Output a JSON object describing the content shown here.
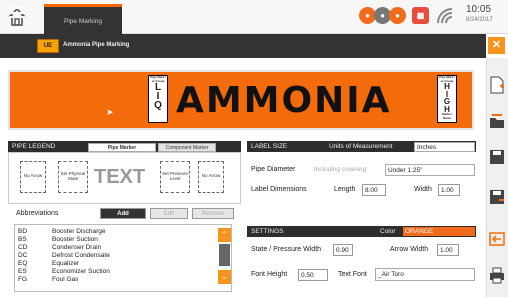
{
  "topbar": {
    "tab_label": "Pipe Marking",
    "clock_time": "10:05",
    "clock_date": "8/24/2017"
  },
  "app": {
    "title": "Ammonia Pipe Marking",
    "logo_text": "UE"
  },
  "label": {
    "main_text": "AMMONIA",
    "left_block": {
      "top": "Pipe Mark / or Group",
      "letters": [
        "L",
        "I",
        "Q"
      ],
      "bottom": ""
    },
    "right_block": {
      "top": "Pipe Mark / or Group",
      "letters": [
        "H",
        "I",
        "G",
        "H"
      ],
      "bottom": "Marker Name"
    },
    "color": "#f36b0a"
  },
  "pipe_legend": {
    "title": "PIPE LEGEND",
    "tabs": [
      "Pipe Marker",
      "Component Marker"
    ],
    "boxes": [
      "No Arrow",
      "Set Physical State",
      "Set Pressure Level",
      "No Arrow"
    ],
    "center_text": "TEXT"
  },
  "abbreviations": {
    "label": "Abbreviations",
    "add": "Add",
    "edit": "Edit",
    "remove": "Remove",
    "rows": [
      {
        "code": "BD",
        "desc": "Booster Discharge"
      },
      {
        "code": "BS",
        "desc": "Booster Suction"
      },
      {
        "code": "CD",
        "desc": "Condenser Drain"
      },
      {
        "code": "DC",
        "desc": "Defrost Condensate"
      },
      {
        "code": "EQ",
        "desc": "Equalizer"
      },
      {
        "code": "ES",
        "desc": "Economizer Suction"
      },
      {
        "code": "FG",
        "desc": "Foul Gas"
      }
    ]
  },
  "label_size": {
    "title": "LABEL SIZE",
    "units_label": "Units of Measurement",
    "units_value": "Inches",
    "pipe_diameter_label": "Pipe Diameter",
    "including_covering": "Including covering",
    "pipe_diameter_value": "Under 1.25\"",
    "dimensions_label": "Label Dimensions",
    "length_label": "Length",
    "length_value": "8.00",
    "width_label": "Width",
    "width_value": "1.00"
  },
  "settings": {
    "title": "SETTINGS",
    "color_label": "Color",
    "color_value": "ORANGE",
    "state_width_label": "State / Pressure Width",
    "state_width_value": "0.90",
    "arrow_width_label": "Arrow Width",
    "arrow_width_value": "1.00",
    "font_height_label": "Font Height",
    "font_height_value": "0.50",
    "text_font_label": "Text Font",
    "text_font_value": "_Air Toro"
  }
}
